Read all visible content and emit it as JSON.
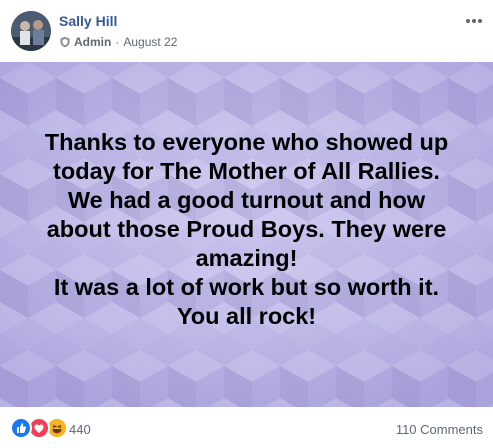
{
  "post": {
    "author": "Sally Hill",
    "role": "Admin",
    "separator": "·",
    "date": "August 22"
  },
  "banner": {
    "lines": [
      "Thanks to everyone who showed up",
      "today for The Mother of All Rallies.",
      "We had a good turnout and how",
      "about those Proud Boys. They were",
      "amazing!",
      "It was a lot of work but so worth it.",
      "You all rock!"
    ],
    "background_color": "#b9b2e6"
  },
  "footer": {
    "reaction_icons": [
      "like-icon",
      "love-icon",
      "haha-icon"
    ],
    "reaction_count": "440",
    "comments": "110 Comments"
  },
  "colors": {
    "author_link": "#385898",
    "like": "#1877f2",
    "love": "#f33e58",
    "haha": "#f7b125"
  }
}
